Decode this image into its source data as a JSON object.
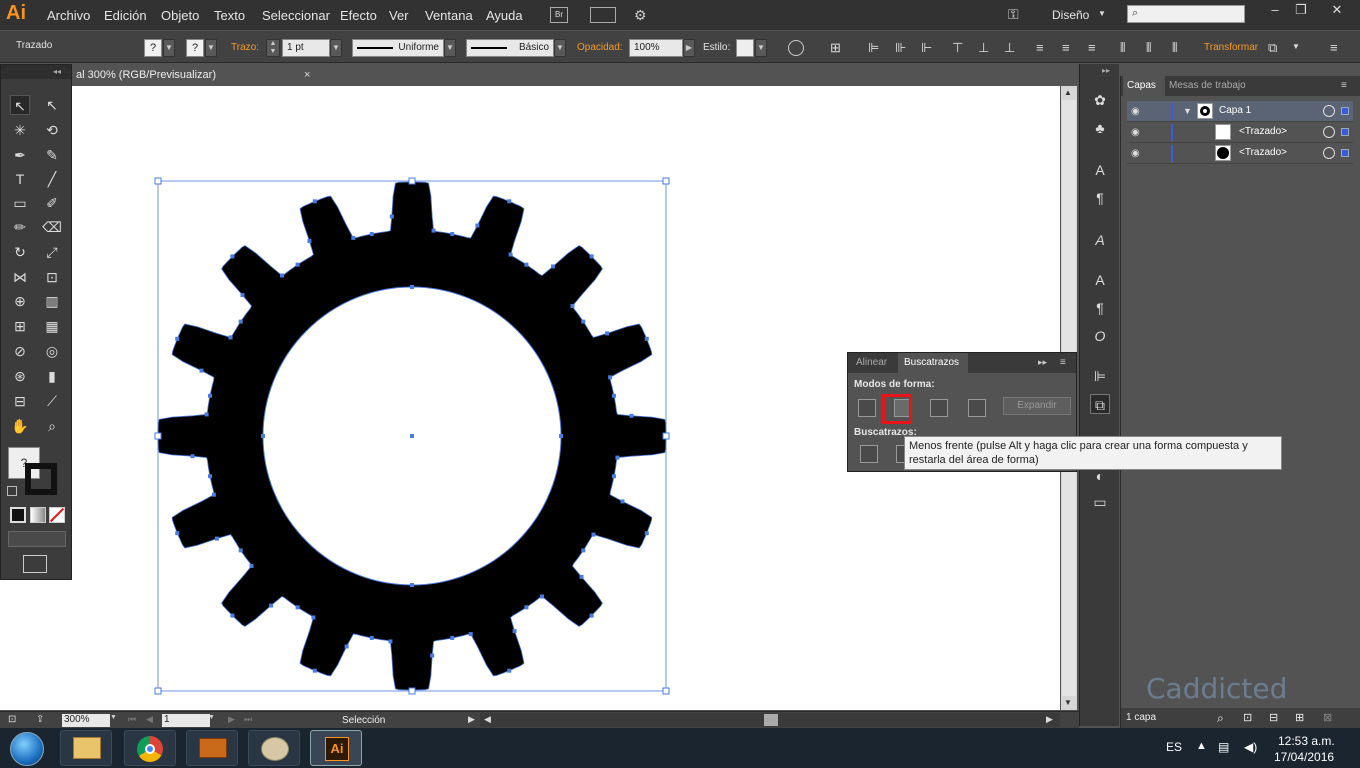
{
  "app": {
    "logo": "Ai",
    "accent": "#f7931e"
  },
  "menu": [
    "Archivo",
    "Edición",
    "Objeto",
    "Texto",
    "Seleccionar",
    "Efecto",
    "Ver",
    "Ventana",
    "Ayuda"
  ],
  "bridge_label": "Br",
  "workspace": "Diseño",
  "control": {
    "object_type": "Trazado",
    "stroke_label": "Trazo:",
    "stroke_weight": "1 pt",
    "profile": "Uniforme",
    "brush": "Básico",
    "opacity_label": "Opacidad:",
    "opacity_value": "100%",
    "style_label": "Estilo:",
    "transform_label": "Transformar"
  },
  "document_tab": {
    "title": "al 300% (RGB/Previsualizar)",
    "close": "×"
  },
  "layers_panel": {
    "tabs": [
      "Capas",
      "Mesas de trabajo"
    ],
    "rows": [
      {
        "name": "Capa 1",
        "thumb": "gear"
      },
      {
        "name": "<Trazado>",
        "thumb": "white"
      },
      {
        "name": "<Trazado>",
        "thumb": "black"
      }
    ],
    "footer": "1 capa"
  },
  "pathfinder": {
    "tabs": [
      "Alinear",
      "Buscatrazos"
    ],
    "shape_modes_label": "Modos de forma:",
    "expand_label": "Expandir",
    "pathfinders_label": "Buscatrazos:",
    "highlight_color": "#e8141a",
    "tooltip": "Menos frente (pulse Alt y haga clic para crear una forma compuesta y restarla del área de forma)"
  },
  "status": {
    "zoom": "300%",
    "page": "1",
    "selection_tool": "Selección"
  },
  "taskbar": {
    "lang": "ES",
    "time": "12:53 a.m.",
    "date": "17/04/2016"
  },
  "watermark": "Caddicted"
}
